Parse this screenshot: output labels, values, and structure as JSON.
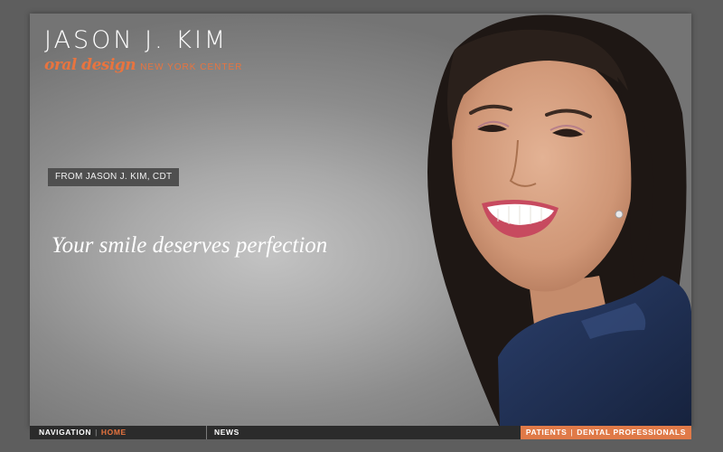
{
  "header": {
    "name": "JASON J. KIM",
    "script_logo": "oral design",
    "center": "NEW YORK CENTER"
  },
  "hero": {
    "badge": "FROM JASON J. KIM, CDT",
    "tagline": "Your smile deserves perfection",
    "image": "smiling-woman-portrait"
  },
  "nav": {
    "label": "NAVIGATION",
    "separator": "|",
    "home": "HOME",
    "news": "NEWS",
    "patients": "PATIENTS",
    "dental_professionals": "DENTAL PROFESSIONALS"
  },
  "colors": {
    "accent": "#e8743f",
    "bar": "#2b2b2b",
    "badge": "#4f4f4f"
  }
}
